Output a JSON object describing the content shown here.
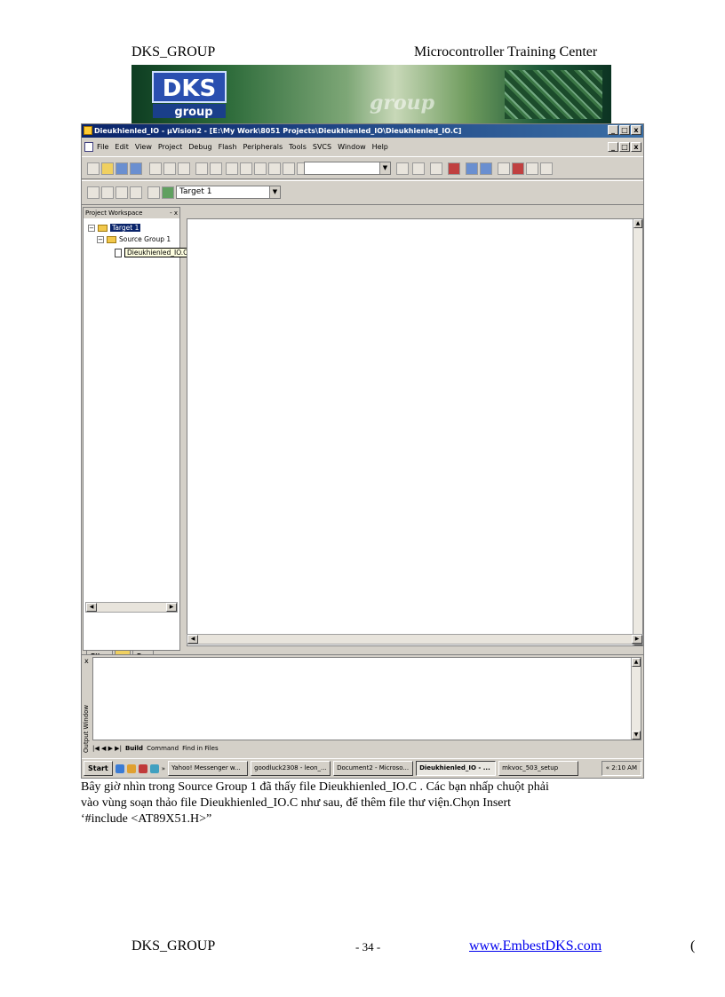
{
  "header": {
    "left": "DKS_GROUP",
    "right": "Microcontroller Training Center"
  },
  "banner": {
    "logo_text": "group",
    "watermark_text": "group"
  },
  "window": {
    "title": "Dieukhienled_IO - µVision2 - [E:\\My Work\\8051 Projects\\Dieukhienled_IO\\Dieukhienled_IO.C]",
    "caption_buttons": [
      "_",
      "□",
      "x"
    ],
    "menu": [
      "File",
      "Edit",
      "View",
      "Project",
      "Debug",
      "Flash",
      "Peripherals",
      "Tools",
      "SVCS",
      "Window",
      "Help"
    ],
    "target_combo": "Target 1",
    "search_combo": "",
    "project_workspace": {
      "title": "Project Workspace",
      "close": "- x",
      "tree": {
        "target": "Target 1",
        "group": "Source Group 1",
        "file": "Dieukhienled_IO.C"
      },
      "tabs": [
        "Files",
        "",
        "B..."
      ]
    },
    "output": {
      "label": "Output Window",
      "close": "x",
      "tabs": [
        "Build",
        "Command",
        "Find in Files"
      ]
    },
    "taskbar": {
      "start": "Start",
      "more": "»",
      "tasks": [
        "Yahoo! Messenger w...",
        "goodluck2308 - leon_...",
        "Document2 - Microso...",
        "Dieukhienled_IO - ...",
        "mkvoc_503_setup"
      ],
      "active_index": 3,
      "tray_arrow": "«",
      "clock": "2:10 AM"
    }
  },
  "paragraph": {
    "line1": "Bây giờ nhìn trong Source Group 1 đã thấy file Dieukhienled_IO.C . Các bạn nhấp chuột phải",
    "line2": "vào vùng soạn thảo file Dieukhienled_IO.C như sau, để thêm file thư viện.Chọn Insert",
    "line3": "‘#include <AT89X51.H>”"
  },
  "footer": {
    "left": "DKS_GROUP",
    "page": "- 34 -",
    "link": "www.EmbestDKS.com",
    "edge": "("
  },
  "colors": {
    "titlebar": "#0a246a",
    "window_bg": "#d4d0c8",
    "link": "#0000ee"
  }
}
